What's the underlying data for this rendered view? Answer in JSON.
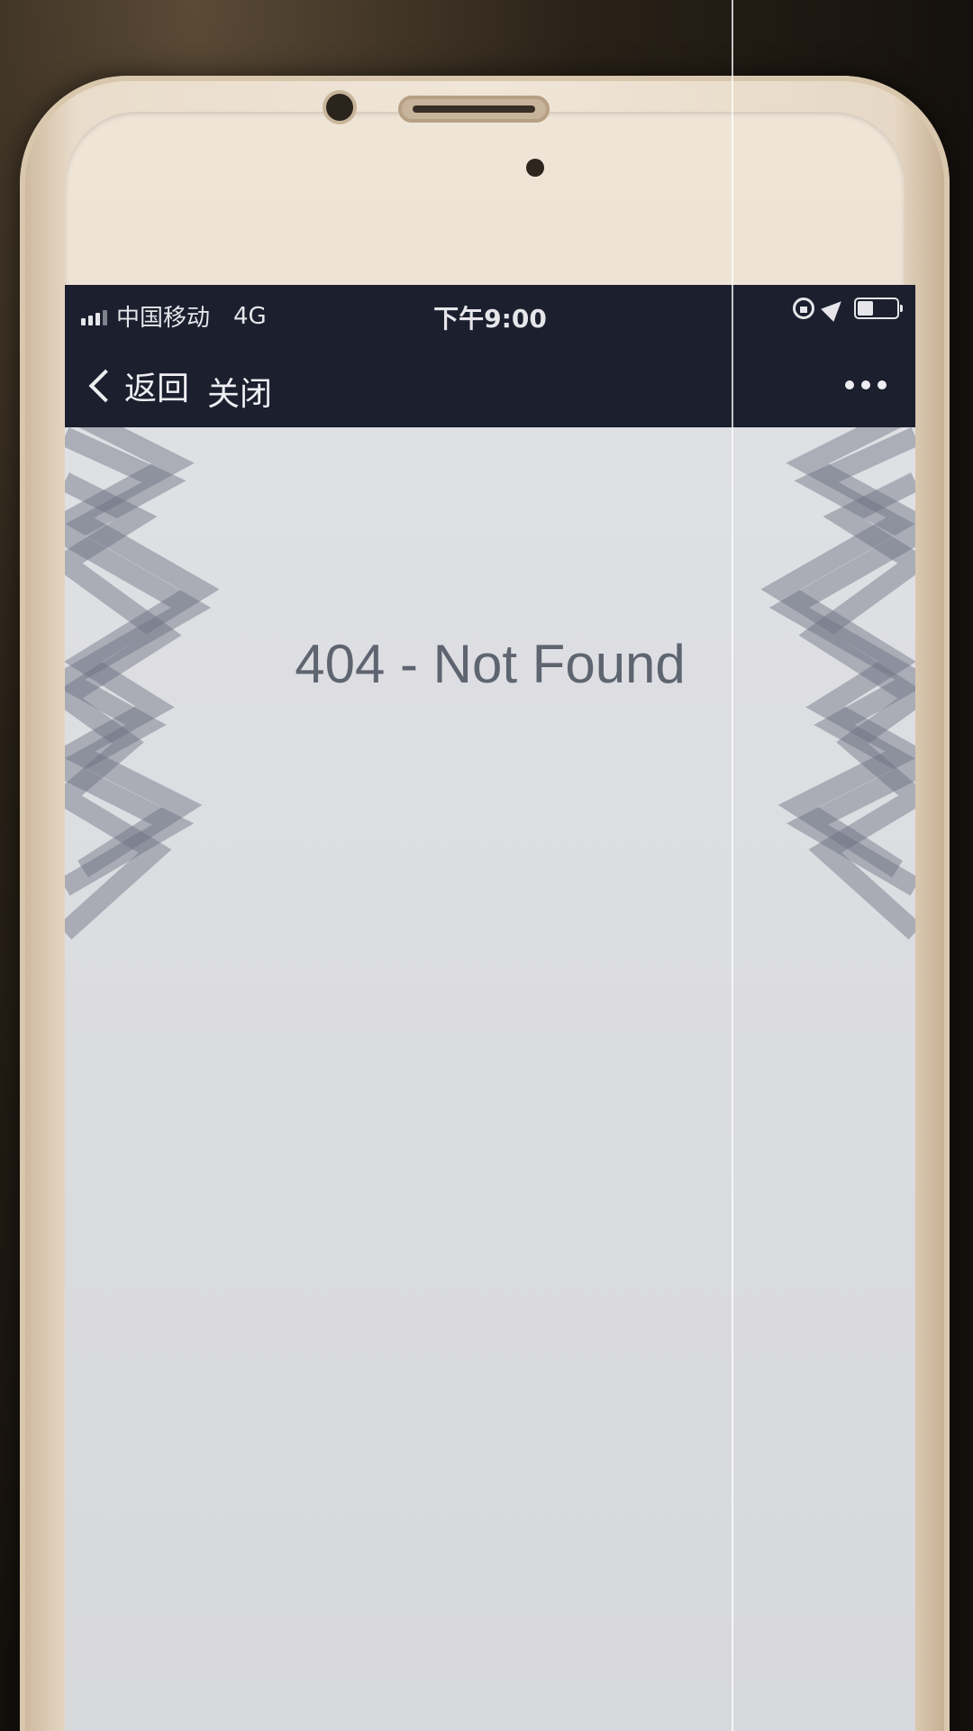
{
  "status_bar": {
    "carrier": "中国移动",
    "network": "4G",
    "time": "下午9:00",
    "icons": [
      "signal-icon",
      "orientation-lock-icon",
      "location-icon",
      "battery-icon"
    ],
    "battery_level": 0.4
  },
  "nav_bar": {
    "back_label": "返回",
    "close_label": "关闭",
    "more_icon": "more-dots-icon",
    "background": "#1b1f2e"
  },
  "main": {
    "error_text": "404 - Not Found",
    "text_color": "#5e6470"
  }
}
